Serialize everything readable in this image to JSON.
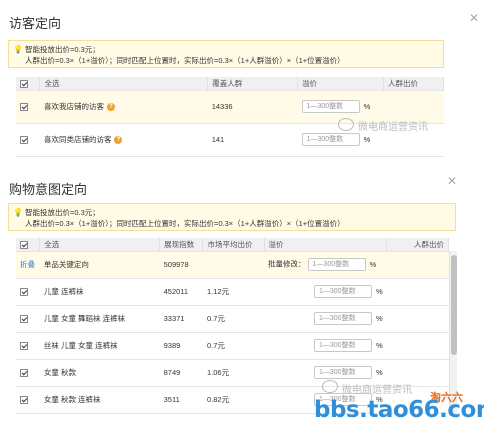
{
  "visitor": {
    "title": "访客定向",
    "tip_line1": "智能投放出价=0.3元；",
    "tip_line2": "人群出价=0.3×（1+溢价）；同时匹配上位置时，实际出价=0.3×（1+人群溢价）×（1+位置溢价）",
    "headers": [
      "全选",
      "覆盖人群",
      "溢价",
      "人群出价"
    ],
    "rows": [
      {
        "checked": true,
        "name": "喜欢我店铺的访客",
        "count": "14336",
        "input_placeholder": "1—300整数",
        "unit": "%"
      },
      {
        "checked": true,
        "name": "喜欢同类店铺的访客",
        "count": "141",
        "input_placeholder": "1—300整数",
        "unit": "%"
      }
    ]
  },
  "shopping": {
    "title": "购物意图定向",
    "tip_line1": "智能投放出价=0.3元；",
    "tip_line2": "人群出价=0.3×（1+溢价）；同时匹配上位置时，实际出价=0.3×（1+人群溢价）×（1+位置溢价）",
    "headers": [
      "全选",
      "展现指数",
      "市场平均出价",
      "溢价",
      "人群出价"
    ],
    "group_row": {
      "toggle": "折叠",
      "name": "单品关键定向",
      "index": "509978",
      "batch_label": "批量修改：",
      "input_placeholder": "1—300整数",
      "unit": "%"
    },
    "rows": [
      {
        "checked": true,
        "name": "儿童 连裤袜",
        "index": "452011",
        "price": "1.12元",
        "input_placeholder": "1—300整数",
        "unit": "%"
      },
      {
        "checked": true,
        "name": "儿童 女童 舞蹈袜 连裤袜",
        "index": "33371",
        "price": "0.7元",
        "input_placeholder": "1—300整数",
        "unit": "%"
      },
      {
        "checked": true,
        "name": "丝袜 儿童 女童 连裤袜",
        "index": "9389",
        "price": "0.7元",
        "input_placeholder": "1—300整数",
        "unit": "%"
      },
      {
        "checked": true,
        "name": "女童 秋款",
        "index": "8749",
        "price": "1.06元",
        "input_placeholder": "1—300整数",
        "unit": "%"
      },
      {
        "checked": true,
        "name": "女童 秋款 连裤袜",
        "index": "3511",
        "price": "0.82元",
        "input_placeholder": "1—300整数",
        "unit": "%"
      }
    ]
  },
  "watermark": {
    "wechat_1": "微电商运营资讯",
    "wechat_2": "微电商运营资讯",
    "site": "bbs.tao66.com",
    "logo": "淘六六"
  },
  "icons": [
    "close-icon",
    "lightbulb-icon",
    "question-icon",
    "checkbox-icon"
  ]
}
